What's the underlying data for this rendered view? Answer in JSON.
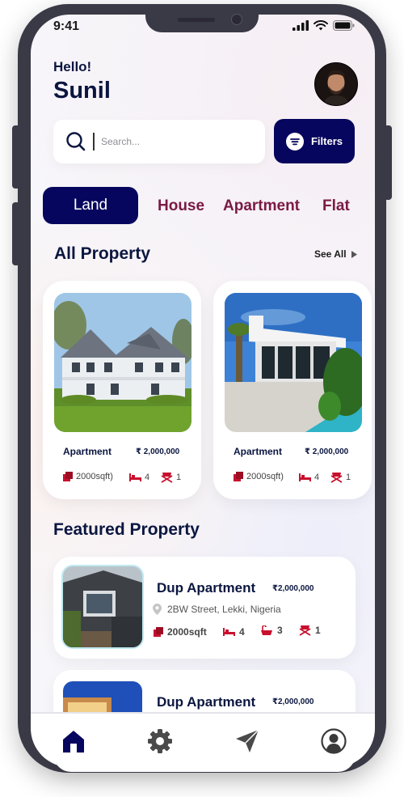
{
  "status_bar": {
    "time": "9:41"
  },
  "header": {
    "greeting": "Hello!",
    "user_name": "Sunil"
  },
  "search": {
    "placeholder": "Search...",
    "filters_label": "Filters"
  },
  "categories": [
    {
      "label": "Land",
      "active": true
    },
    {
      "label": "House",
      "active": false
    },
    {
      "label": "Apartment",
      "active": false
    },
    {
      "label": "Flat",
      "active": false
    }
  ],
  "all_property": {
    "title": "All Property",
    "see_all": "See All",
    "cards": [
      {
        "type": "Apartment",
        "price": "₹ 2,000,000",
        "area": "2000sqft)",
        "beds": "4",
        "baths": "1"
      },
      {
        "type": "Apartment",
        "price": "₹ 2,000,000",
        "area": "2000sqft)",
        "beds": "4",
        "baths": "1"
      }
    ]
  },
  "featured_property": {
    "title": "Featured Property",
    "items": [
      {
        "name": "Dup Apartment",
        "price": "₹2,000,000",
        "address": "2BW Street, Lekki, Nigeria",
        "area": "2000sqft",
        "beds": "4",
        "baths": "3",
        "extra": "1"
      },
      {
        "name": "Dup Apartment",
        "price": "₹2,000,000"
      }
    ]
  },
  "colors": {
    "primary": "#07065e",
    "accent": "#7a1a45",
    "icon_red": "#c8102e"
  },
  "bottom_nav": [
    {
      "icon": "home-icon",
      "active": true
    },
    {
      "icon": "gear-icon",
      "active": false
    },
    {
      "icon": "send-icon",
      "active": false
    },
    {
      "icon": "profile-icon",
      "active": false
    }
  ]
}
